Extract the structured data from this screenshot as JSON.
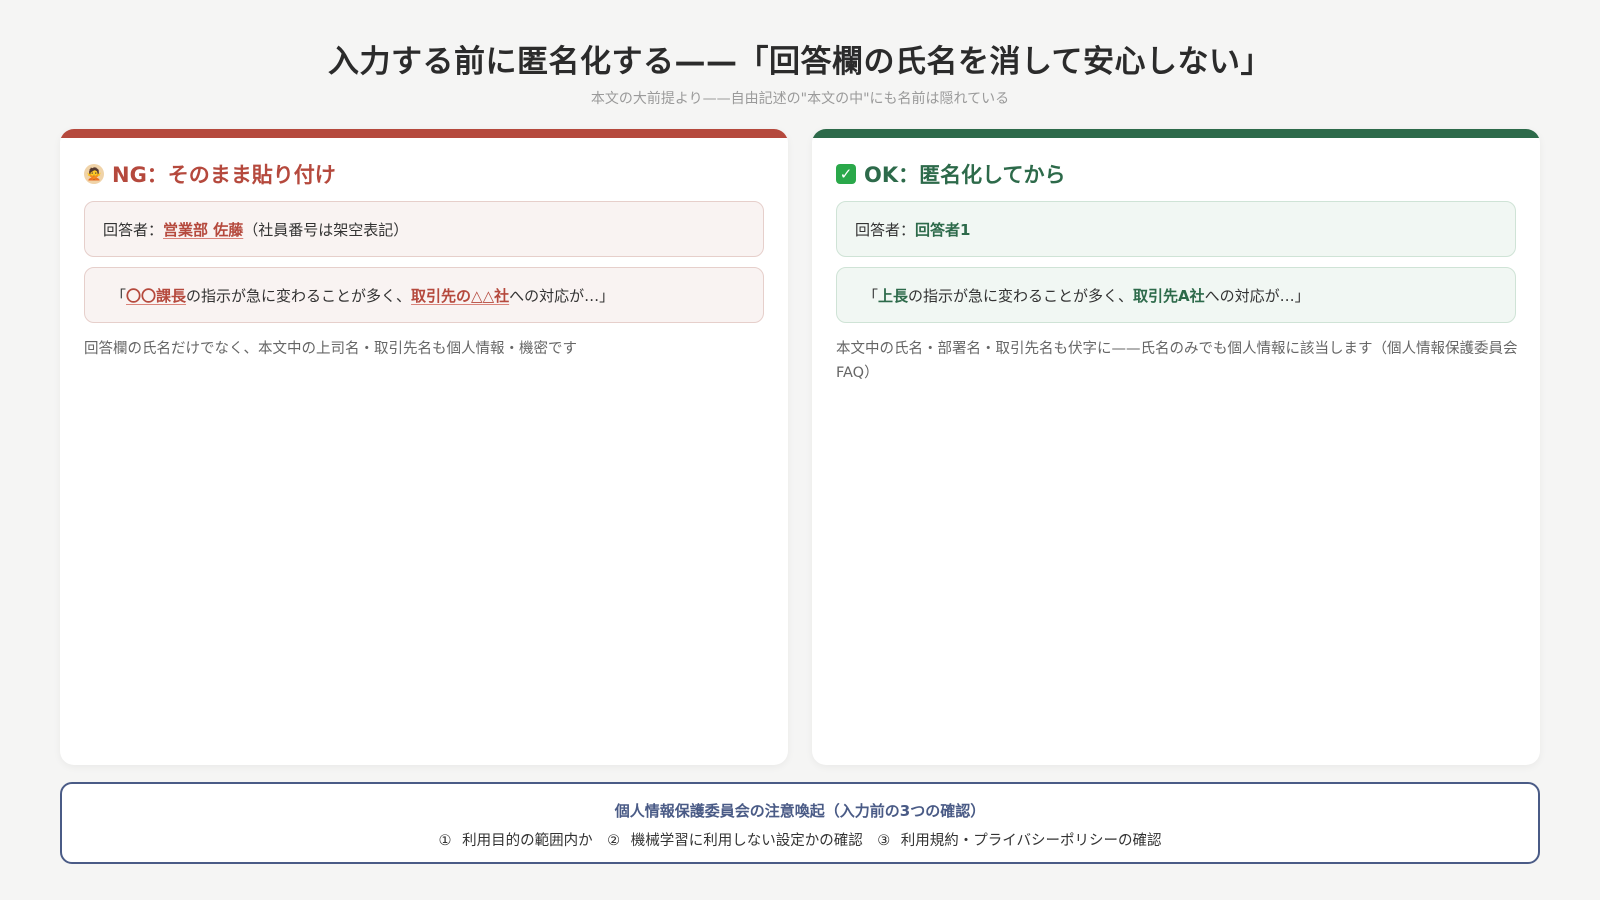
{
  "header": {
    "title": "入力する前に匿名化する——「回答欄の氏名を消して安心しない」",
    "subtitle": "本文の大前提より——自由記述の\"本文の中\"にも名前は隠れている"
  },
  "ng": {
    "icon": "person-gesturing-no-icon",
    "icon_glyph": "🙅",
    "heading": "NG：そのまま貼り付け",
    "accent": "#b5493d",
    "row1_prefix": "回答者：",
    "row1_name": "営業部 佐藤",
    "row1_suffix": "（社員番号は架空表記）",
    "row2_open": "「",
    "row2_hl1": "〇〇課長",
    "row2_mid": "の指示が急に変わることが多く、",
    "row2_hl2": "取引先の△△社",
    "row2_end": "への対応が…」",
    "note": "回答欄の氏名だけでなく、本文中の上司名・取引先名も個人情報・機密です"
  },
  "ok": {
    "icon": "check-mark-icon",
    "icon_glyph": "✓",
    "heading": "OK：匿名化してから",
    "accent": "#2d6a4a",
    "row1_prefix": "回答者：",
    "row1_name": "回答者1",
    "row2_open": "「",
    "row2_hl1": "上長",
    "row2_mid": "の指示が急に変わることが多く、",
    "row2_hl2": "取引先A社",
    "row2_end": "への対応が…」",
    "note": "本文中の氏名・部署名・取引先名も伏字に——氏名のみでも個人情報に該当します（個人情報保護委員会FAQ）"
  },
  "footer": {
    "title": "個人情報保護委員会の注意喚起（入力前の3つの確認）",
    "items": "① 利用目的の範囲内か　② 機械学習に利用しない設定かの確認　③ 利用規約・プライバシーポリシーの確認",
    "border_color": "#4a5b86"
  }
}
